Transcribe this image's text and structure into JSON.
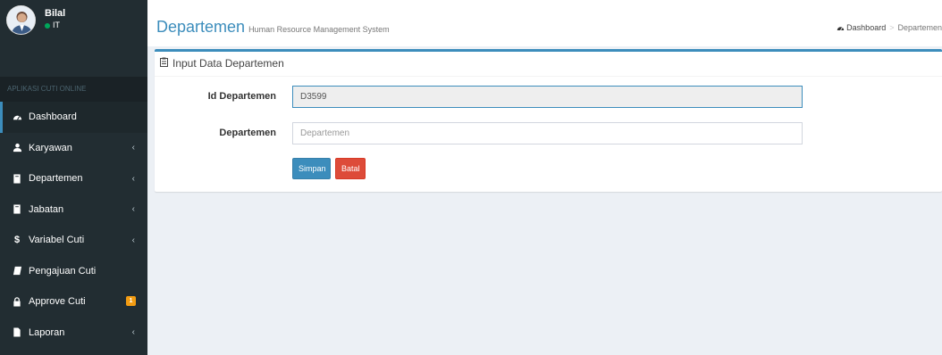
{
  "user": {
    "name": "Bilal",
    "status": "IT"
  },
  "sidebar": {
    "header": "APLIKASI CUTI ONLINE",
    "items": [
      {
        "label": "Dashboard",
        "icon": "dashboard-icon",
        "active": true,
        "chevron": false
      },
      {
        "label": "Karyawan",
        "icon": "user-icon",
        "chevron": true
      },
      {
        "label": "Departemen",
        "icon": "book-icon",
        "chevron": true
      },
      {
        "label": "Jabatan",
        "icon": "book-icon",
        "chevron": true
      },
      {
        "label": "Variabel Cuti",
        "icon": "dollar-icon",
        "chevron": true
      },
      {
        "label": "Pengajuan Cuti",
        "icon": "file-icon",
        "chevron": false
      },
      {
        "label": "Approve Cuti",
        "icon": "lock-icon",
        "chevron": false,
        "badge": "1"
      },
      {
        "label": "Laporan",
        "icon": "document-icon",
        "chevron": true
      }
    ]
  },
  "header": {
    "title": "Departemen",
    "subtitle": "Human Resource Management System",
    "breadcrumb": {
      "home": "Dashboard",
      "current": "Departemen"
    }
  },
  "form": {
    "box_title": "Input Data Departemen",
    "id_label": "Id Departemen",
    "id_value": "D3599",
    "dept_label": "Departemen",
    "dept_placeholder": "Departemen",
    "save_label": "Simpan",
    "cancel_label": "Batal"
  },
  "colors": {
    "accent": "#3c8dbc",
    "danger": "#dd4b39",
    "sidebar": "#222d32",
    "badge": "#f39c12"
  }
}
